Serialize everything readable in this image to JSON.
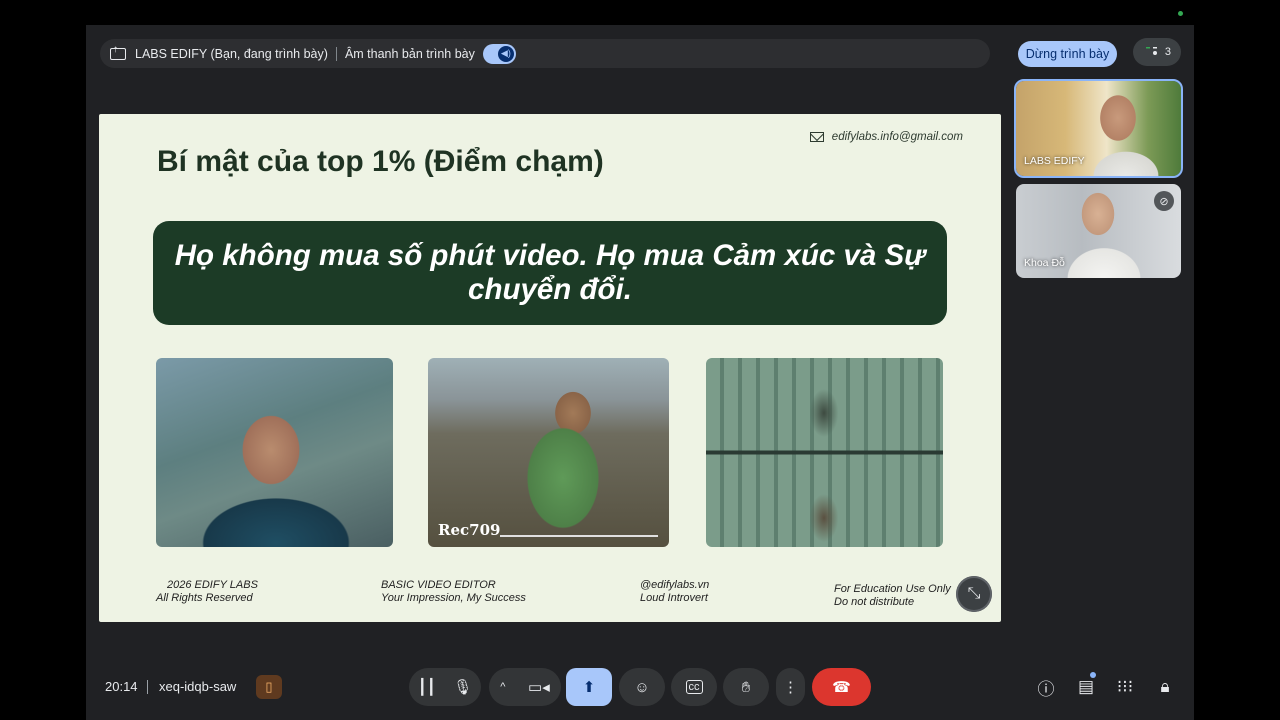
{
  "presenting_bar": {
    "presenter_text": "LABS EDIFY (Bạn, đang trình bày)",
    "audio_label": "Âm thanh bản trình bày"
  },
  "header": {
    "stop_presenting": "Dừng trình bày",
    "participant_count": "3"
  },
  "slide": {
    "email": "edifylabs.info@gmail.com",
    "title": "Bí mật của top 1% (Điểm chạm)",
    "quote": "Họ không mua số phút video. Họ mua Cảm xúc và Sự chuyển đổi.",
    "image2_caption": "Rec709",
    "footer": {
      "copyright_line1": "2026 EDIFY LABS",
      "copyright_line2": "All Rights Reserved",
      "course_line1": "BASIC VIDEO EDITOR",
      "course_line2": "Your Impression, My Success",
      "handle_line1": "@edifylabs.vn",
      "handle_line2": "Loud Introvert",
      "notice_line1": "For Education Use Only",
      "notice_line2": "Do not distribute"
    }
  },
  "participants": [
    {
      "name": "LABS EDIFY"
    },
    {
      "name": "Khoa Đỗ"
    }
  ],
  "bottom_bar": {
    "time": "20:14",
    "meeting_code": "xeq-idqb-saw"
  },
  "colors": {
    "slide_bg": "#eef3e4",
    "slide_dark_green": "#1c3b26",
    "accent_blue": "#a8c7fa",
    "end_call_red": "#dc362e"
  }
}
